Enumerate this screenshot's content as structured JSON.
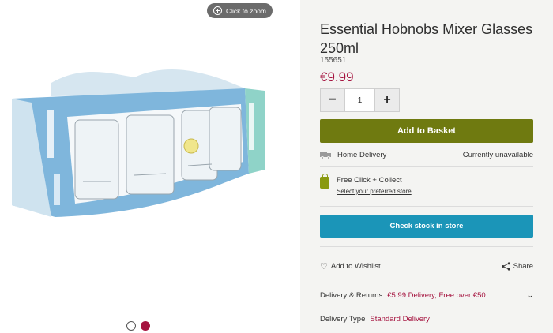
{
  "gallery": {
    "zoom_label": "Click to zoom",
    "slide_count": 2,
    "active_slide": 2
  },
  "product": {
    "title": "Essential Hobnobs Mixer Glasses 250ml",
    "sku": "155651",
    "price": "€9.99",
    "quantity": "1",
    "qty_minus": "−",
    "qty_plus": "+",
    "add_to_basket": "Add to Basket"
  },
  "delivery": {
    "home_label": "Home Delivery",
    "home_status": "Currently unavailable",
    "click_collect_label": "Free Click + Collect",
    "select_store_link": "Select your preferred store",
    "check_stock": "Check stock in store"
  },
  "actions": {
    "wishlist": "Add to Wishlist",
    "share": "Share"
  },
  "details": {
    "returns_label": "Delivery & Returns",
    "returns_value": "€5.99 Delivery, Free over €50",
    "type_label": "Delivery Type",
    "type_value": "Standard Delivery"
  },
  "colors": {
    "brand_price": "#a5133f",
    "add_button": "#6f7a10",
    "stock_button": "#1b95b8",
    "panel_bg": "#f4f4f2"
  },
  "icons": [
    "zoom-plus-icon",
    "truck-icon",
    "shopping-bag-icon",
    "heart-icon",
    "share-icon",
    "chevron-down-icon"
  ]
}
